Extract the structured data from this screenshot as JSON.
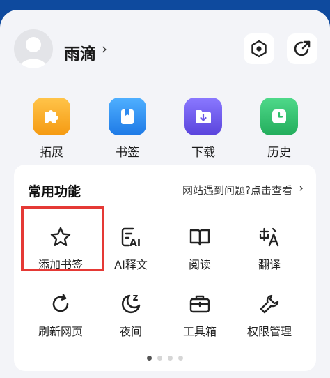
{
  "profile": {
    "username": "雨滴",
    "chevron": "›"
  },
  "header_actions": [
    {
      "icon": "hexagon-settings-icon"
    },
    {
      "icon": "share-arrow-icon"
    }
  ],
  "quick_actions": [
    {
      "label": "拓展",
      "icon": "puzzle-icon",
      "color": "#f7a81d"
    },
    {
      "label": "书签",
      "icon": "bookmark-icon",
      "color": "#2e8bf0"
    },
    {
      "label": "下载",
      "icon": "download-folder-icon",
      "color": "#6a55e6"
    },
    {
      "label": "历史",
      "icon": "clock-icon",
      "color": "#2fbf6a"
    }
  ],
  "common_functions": {
    "title": "常用功能",
    "help_link": "网站遇到问题?点击查看",
    "help_chevron": "›",
    "items": [
      {
        "label": "添加书签",
        "icon": "star-icon"
      },
      {
        "label": "AI释文",
        "icon": "ai-document-icon"
      },
      {
        "label": "阅读",
        "icon": "book-icon"
      },
      {
        "label": "翻译",
        "icon": "translate-icon"
      },
      {
        "label": "刷新网页",
        "icon": "refresh-icon"
      },
      {
        "label": "夜间",
        "icon": "moon-icon"
      },
      {
        "label": "工具箱",
        "icon": "toolbox-icon"
      },
      {
        "label": "权限管理",
        "icon": "wrench-icon"
      }
    ],
    "pagination": {
      "pages": 4,
      "active": 0
    }
  }
}
